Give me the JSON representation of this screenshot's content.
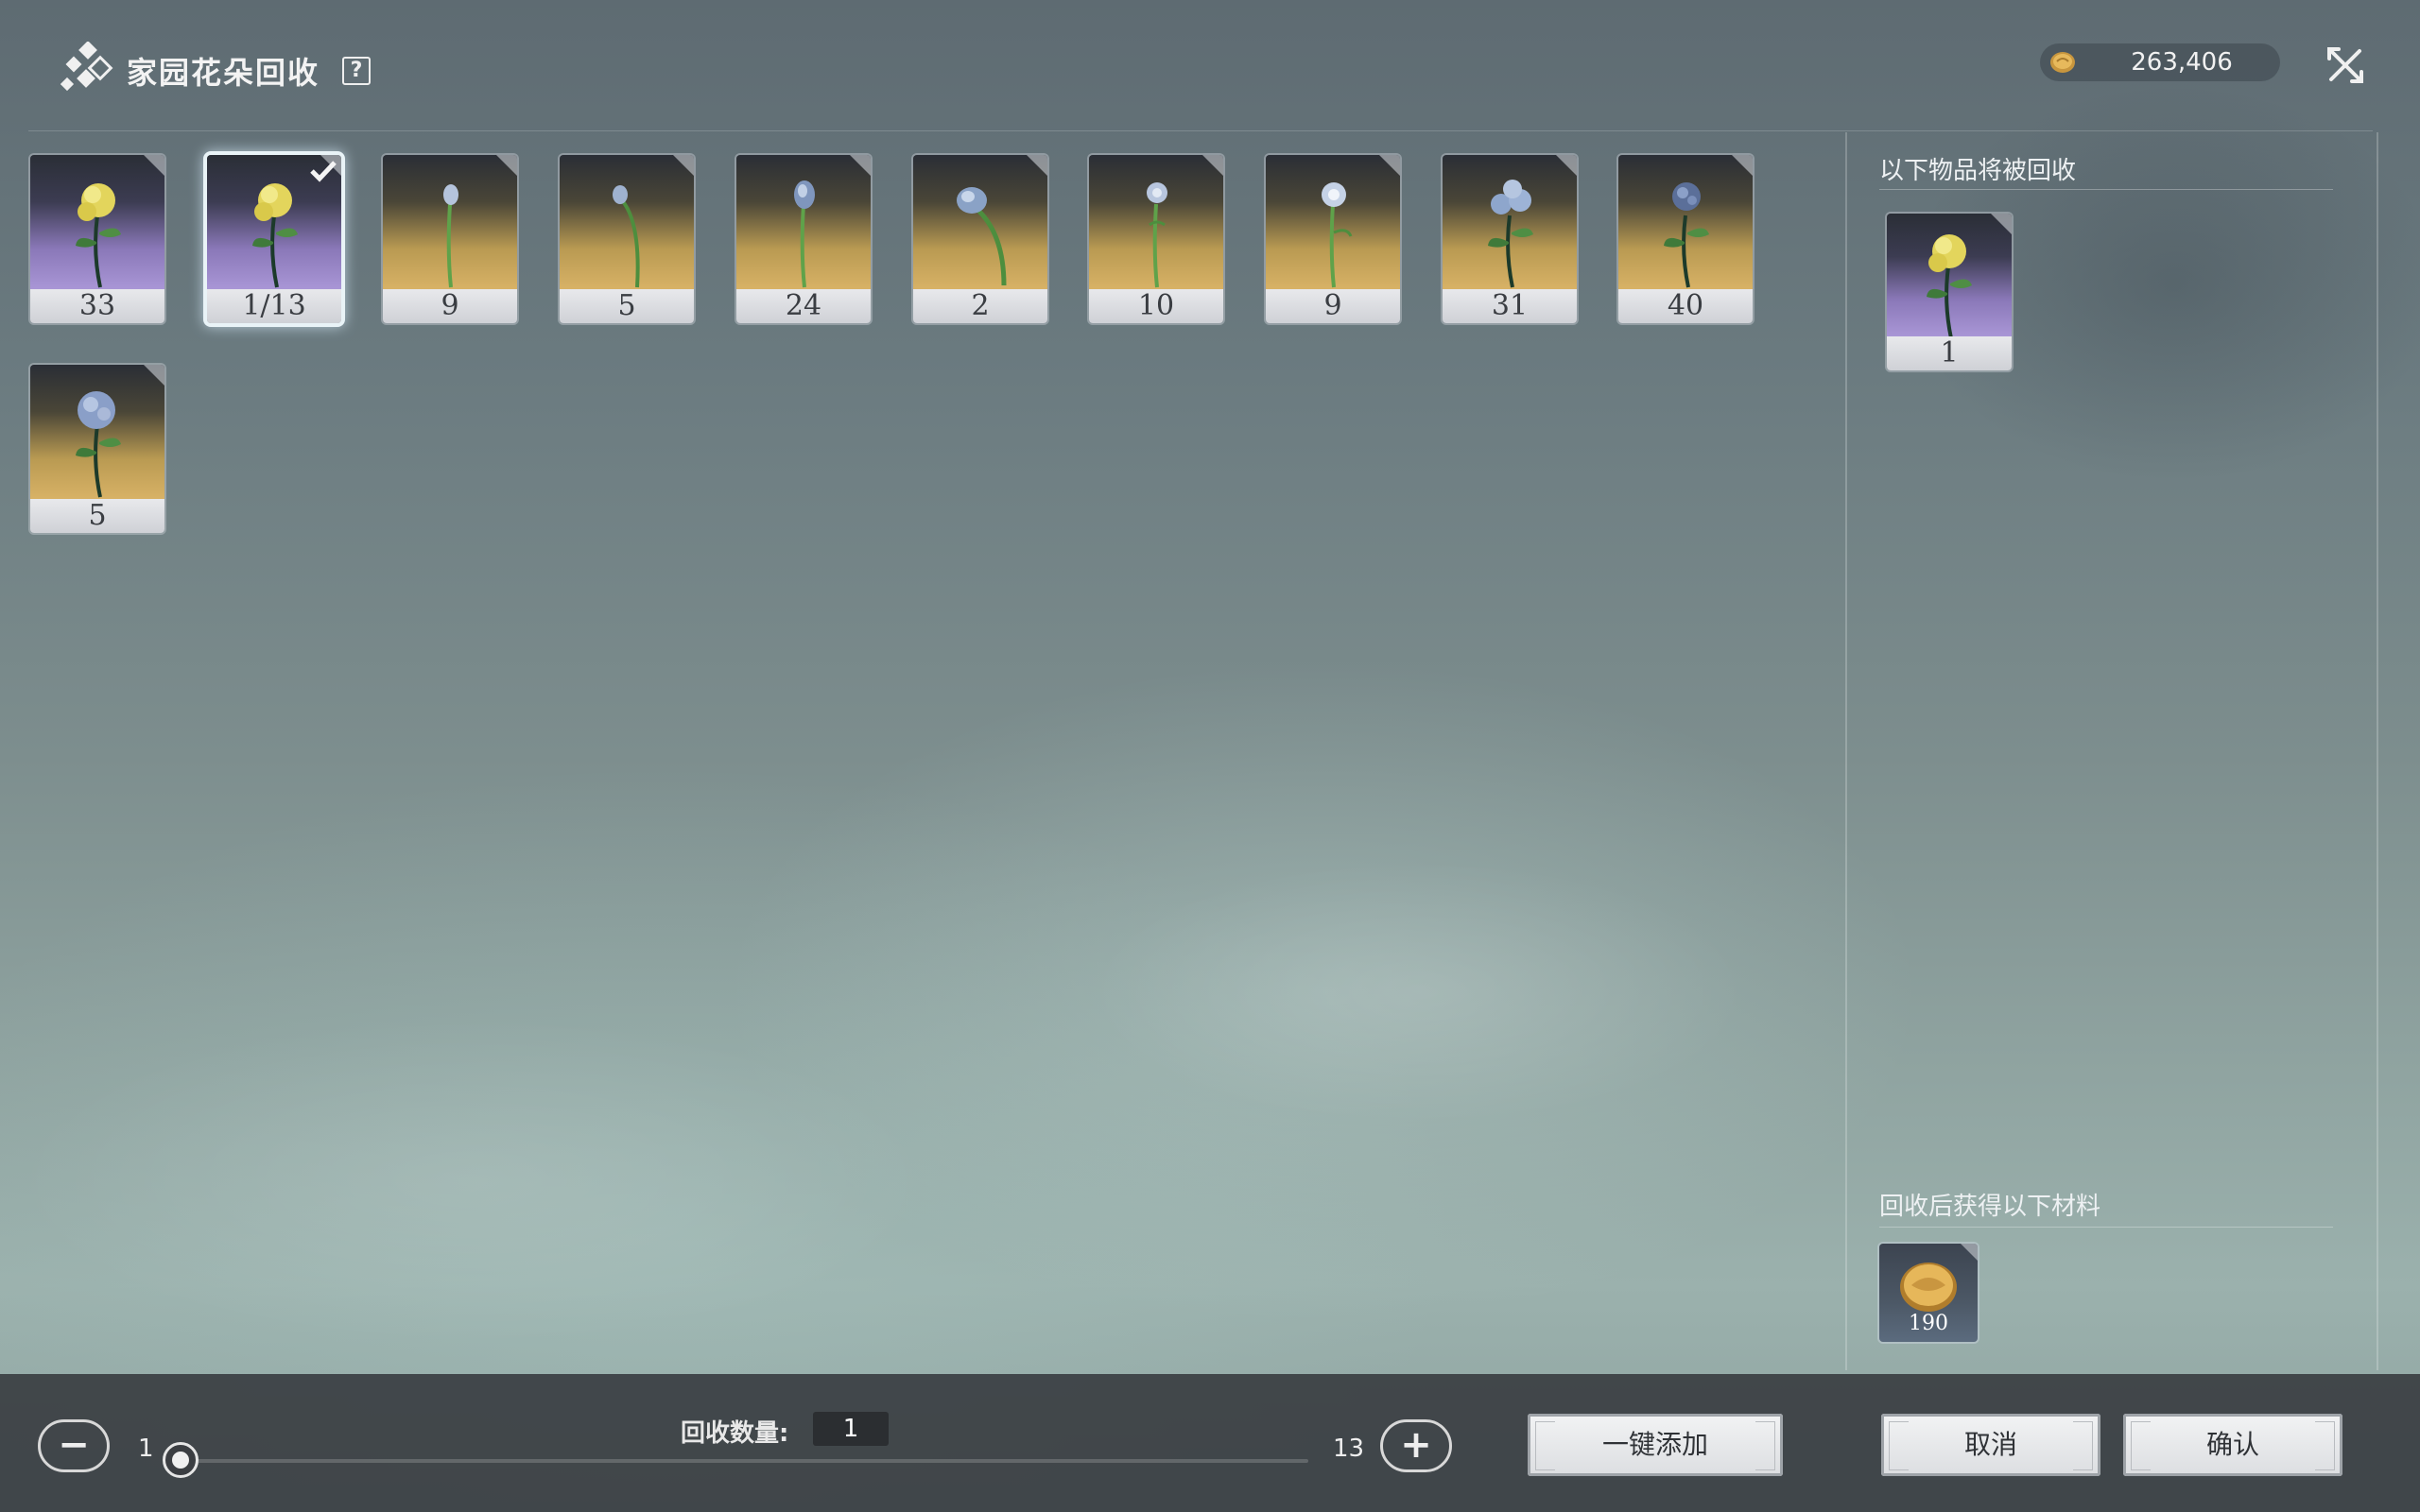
{
  "header": {
    "title": "家园花朵回收",
    "help_label": "?",
    "currency_amount": "263,406"
  },
  "inventory": {
    "items": [
      {
        "count": "33",
        "rarity": "purple",
        "flower": "yellow-pom",
        "selected": false
      },
      {
        "count": "1/13",
        "rarity": "purple",
        "flower": "yellow-pom",
        "selected": true
      },
      {
        "count": "9",
        "rarity": "gold",
        "flower": "blue-bud-small",
        "selected": false
      },
      {
        "count": "5",
        "rarity": "gold",
        "flower": "blue-bud-bent",
        "selected": false
      },
      {
        "count": "24",
        "rarity": "gold",
        "flower": "blue-bud-tall",
        "selected": false
      },
      {
        "count": "2",
        "rarity": "gold",
        "flower": "blue-bulb-curved",
        "selected": false
      },
      {
        "count": "10",
        "rarity": "gold",
        "flower": "blue-rose",
        "selected": false
      },
      {
        "count": "9",
        "rarity": "gold",
        "flower": "blue-rose-open",
        "selected": false
      },
      {
        "count": "31",
        "rarity": "gold",
        "flower": "blue-cluster",
        "selected": false
      },
      {
        "count": "40",
        "rarity": "gold",
        "flower": "blue-clover",
        "selected": false
      },
      {
        "count": "5",
        "rarity": "gold",
        "flower": "blue-hydrangea",
        "selected": false
      }
    ]
  },
  "recycle_panel": {
    "items_label": "以下物品将被回收",
    "selected_item": {
      "count": "1",
      "rarity": "purple",
      "flower": "yellow-pom"
    },
    "rewards_label": "回收后获得以下材料",
    "reward": {
      "value": "190",
      "icon": "gold-coin-icon"
    }
  },
  "bottom_bar": {
    "min_value": "1",
    "max_value": "13",
    "qty_label": "回收数量:",
    "qty_value": "1",
    "slider_fraction": 0,
    "add_all_label": "一键添加",
    "cancel_label": "取消",
    "confirm_label": "确认"
  },
  "colors": {
    "purple_rarity": "#a996d6",
    "gold_rarity": "#d8b266",
    "bottom_bar": "#3a3e42"
  }
}
